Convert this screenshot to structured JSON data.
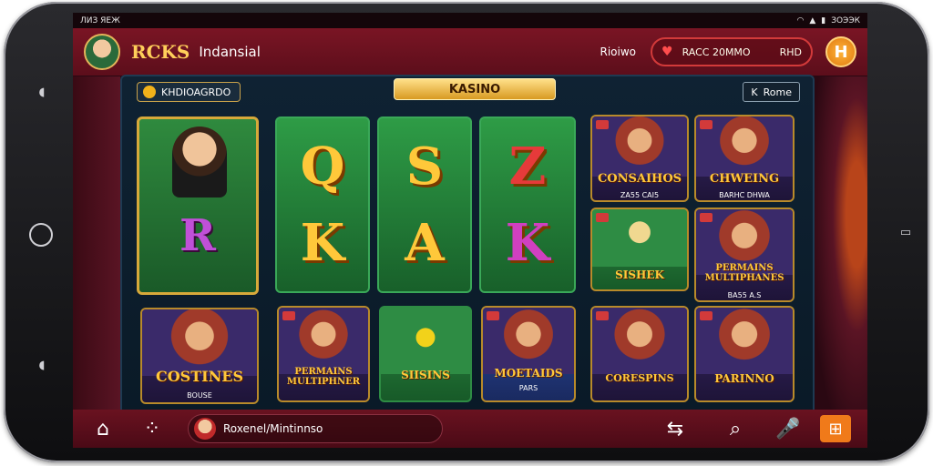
{
  "status_bar": {
    "left": "ЛИЗ ЯЕЖ",
    "right": "ЗОЭЭК"
  },
  "header": {
    "brand": "RCKS",
    "region": "Indansial",
    "link": "Rioiwo",
    "wallet_text": "RACC 20MMO",
    "wallet_action": "RHD",
    "action_button": "H"
  },
  "panel": {
    "chip_label": "KHDIOAGRDO",
    "title": "KASINO",
    "home_link": "Rome",
    "home_prefix": "K"
  },
  "tiles": {
    "feature_letter": "R",
    "letters": [
      "Q",
      "S",
      "Z",
      "K",
      "A",
      "K"
    ],
    "cards": [
      {
        "title": "CONSAIHOS",
        "sub": "ZA55 CAI5"
      },
      {
        "title": "CHWEING",
        "sub": "BARHC DHWA"
      },
      {
        "title": "SISHEK",
        "sub": ""
      },
      {
        "title": "PERMAINS MULTIPHANES",
        "sub": "BA55 A.S"
      },
      {
        "title": "COSTINES",
        "sub": "BOUSE"
      },
      {
        "title": "PERMAINS MULTIPHNER",
        "sub": ""
      },
      {
        "title": "SIISINS",
        "sub": ""
      },
      {
        "title": "MOETAIDS",
        "sub": "PARS"
      },
      {
        "title": "CORESPINS",
        "sub": ""
      },
      {
        "title": "PARINNO",
        "sub": ""
      }
    ]
  },
  "bottom_nav": {
    "username": "Roxenel/Mintinnso"
  }
}
